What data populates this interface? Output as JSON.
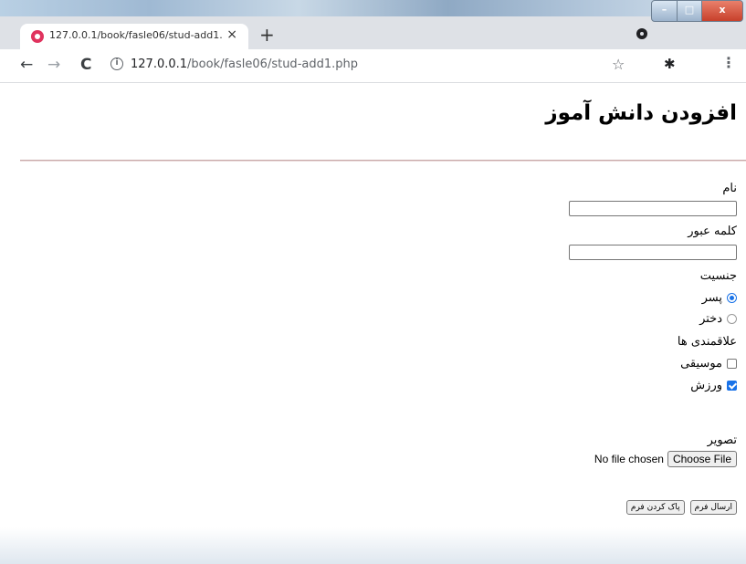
{
  "browser": {
    "tab_title": "127.0.0.1/book/fasle06/stud-add1.php",
    "tab_close": "×",
    "new_tab": "+",
    "nav_back": "←",
    "nav_forward": "→",
    "nav_reload": "C",
    "info_icon": "i",
    "url_host": "127.0.0.1",
    "url_path": "/book/fasle06/stud-add1.php",
    "star": "☆",
    "extension": "✱",
    "menu": "⋮",
    "window_controls": {
      "minimize": "–",
      "maximize": "□",
      "close": "x"
    }
  },
  "page": {
    "title": "افزودن دانش آموز",
    "form": {
      "name_label": "نام",
      "name_value": "",
      "password_label": "کلمه عبور",
      "password_value": "",
      "gender_label": "جنسیت",
      "gender_options": [
        {
          "label": "پسر",
          "checked": true
        },
        {
          "label": "دختر",
          "checked": false
        }
      ],
      "interests_label": "علاقمندی ها",
      "interests_options": [
        {
          "label": "موسیقی",
          "checked": false
        },
        {
          "label": "ورزش",
          "checked": true
        }
      ],
      "image_label": "تصویر",
      "file_status": "No file chosen",
      "file_button": "Choose File",
      "submit_button": "ارسال فرم",
      "reset_button": "پاک کردن فرم"
    }
  },
  "colors": {
    "accent": "#1a73e8",
    "favicon": "#e0335e",
    "divider": "#c9a9a9"
  }
}
